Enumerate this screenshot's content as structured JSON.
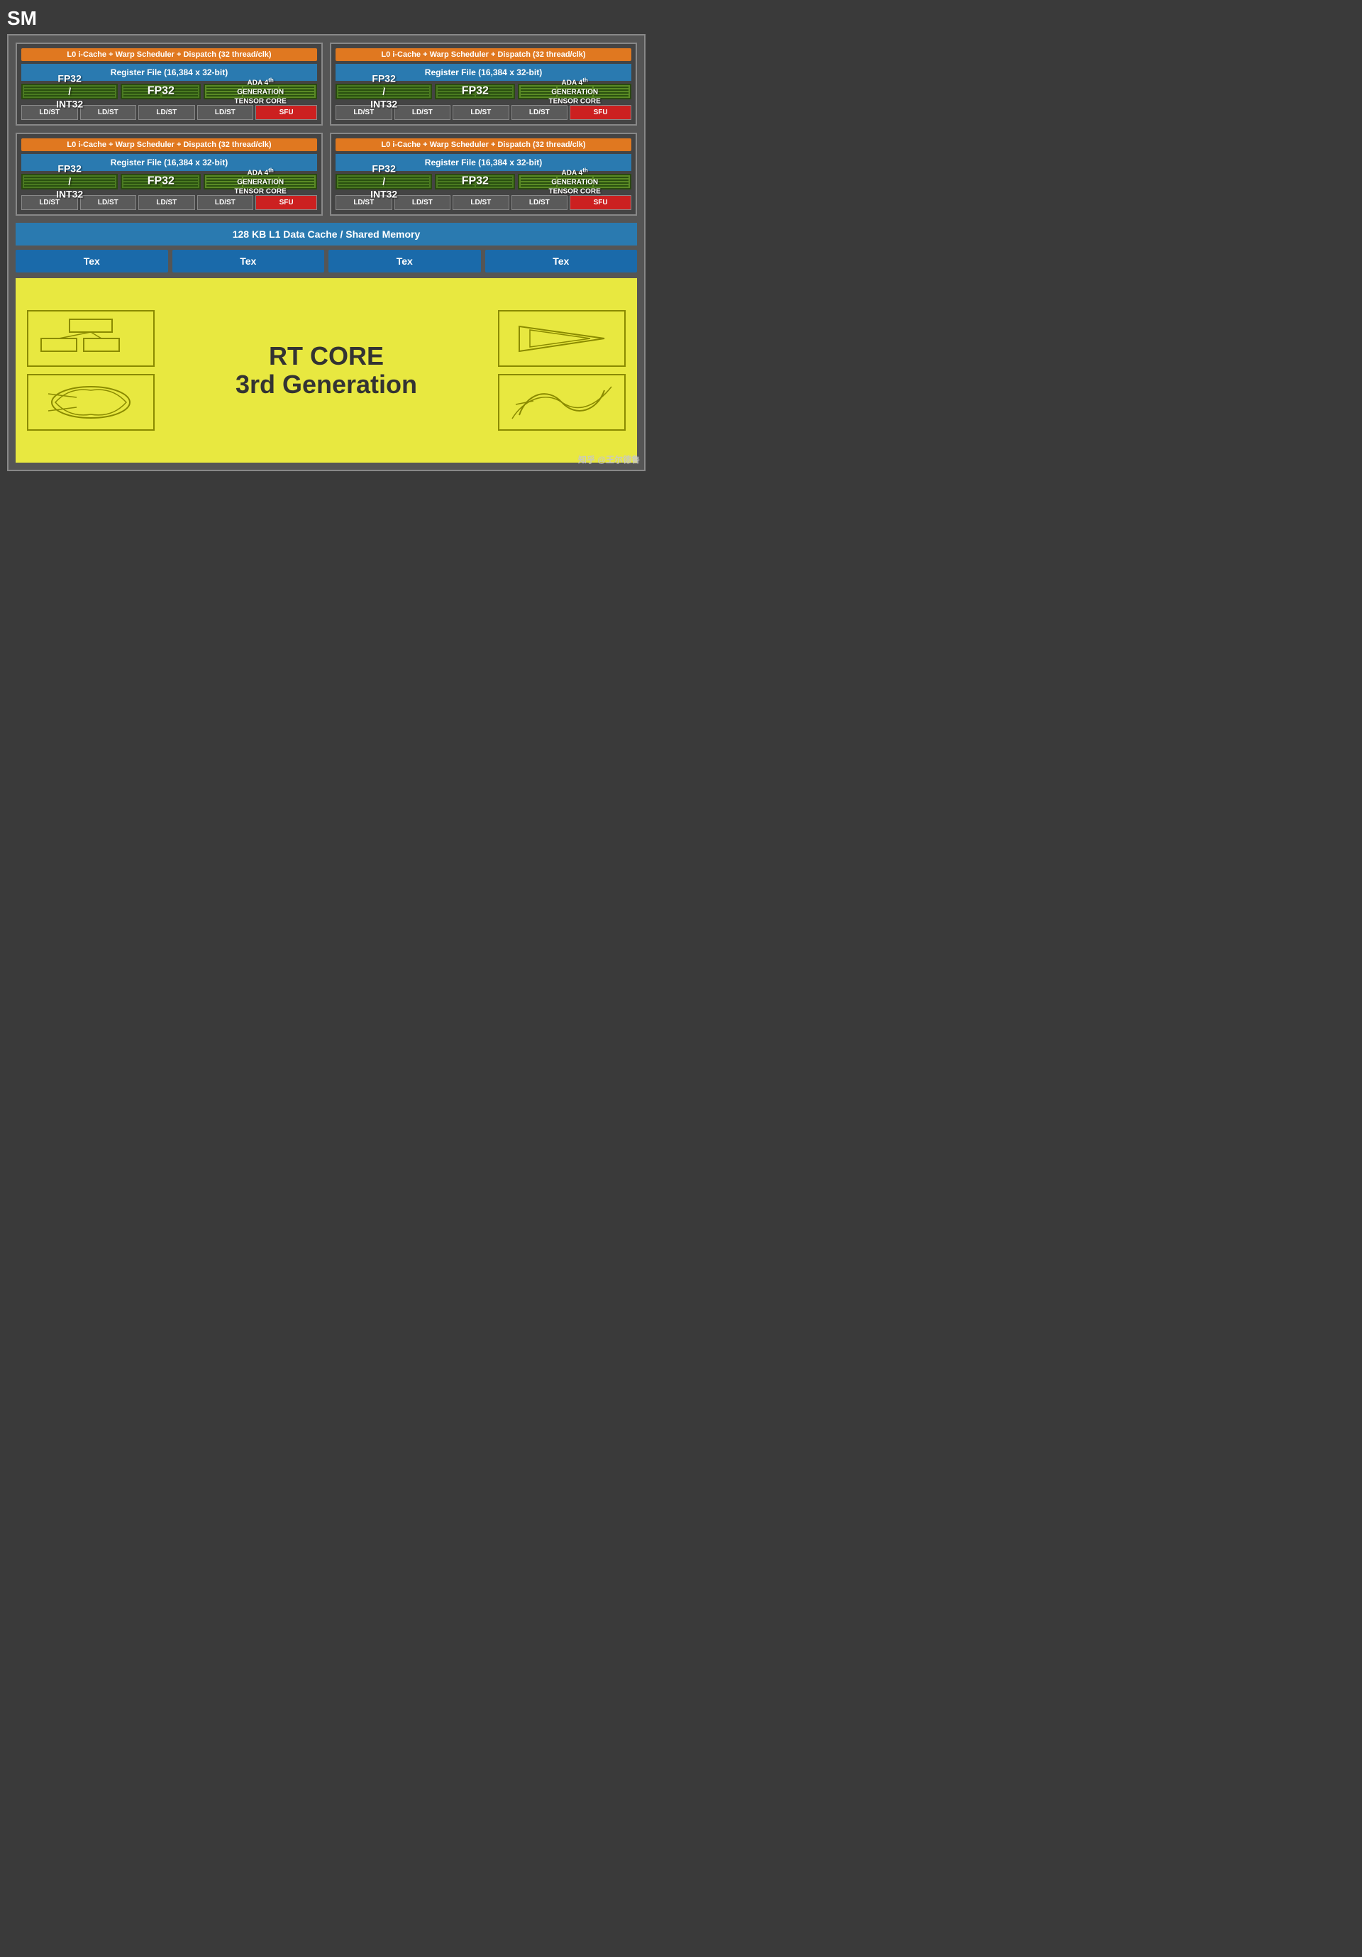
{
  "title": "SM",
  "quadrants": [
    {
      "id": "q1",
      "warp_label": "L0 i-Cache + Warp Scheduler + Dispatch (32 thread/clk)",
      "register_label": "Register File (16,384 x 32-bit)",
      "fp32_int32_label": "FP32\n/\nINT32",
      "fp32_label": "FP32",
      "tensor_label": "ADA 4th GENERATION TENSOR CORE",
      "ldst_labels": [
        "LD/ST",
        "LD/ST",
        "LD/ST",
        "LD/ST"
      ],
      "sfu_label": "SFU"
    },
    {
      "id": "q2",
      "warp_label": "L0 i-Cache + Warp Scheduler + Dispatch (32 thread/clk)",
      "register_label": "Register File (16,384 x 32-bit)",
      "fp32_int32_label": "FP32\n/\nINT32",
      "fp32_label": "FP32",
      "tensor_label": "ADA 4th GENERATION TENSOR CORE",
      "ldst_labels": [
        "LD/ST",
        "LD/ST",
        "LD/ST",
        "LD/ST"
      ],
      "sfu_label": "SFU"
    },
    {
      "id": "q3",
      "warp_label": "L0 i-Cache + Warp Scheduler + Dispatch (32 thread/clk)",
      "register_label": "Register File (16,384 x 32-bit)",
      "fp32_int32_label": "FP32\n/\nINT32",
      "fp32_label": "FP32",
      "tensor_label": "ADA 4th GENERATION TENSOR CORE",
      "ldst_labels": [
        "LD/ST",
        "LD/ST",
        "LD/ST",
        "LD/ST"
      ],
      "sfu_label": "SFU"
    },
    {
      "id": "q4",
      "warp_label": "L0 i-Cache + Warp Scheduler + Dispatch (32 thread/clk)",
      "register_label": "Register File (16,384 x 32-bit)",
      "fp32_int32_label": "FP32\n/\nINT32",
      "fp32_label": "FP32",
      "tensor_label": "ADA 4th GENERATION TENSOR CORE",
      "ldst_labels": [
        "LD/ST",
        "LD/ST",
        "LD/ST",
        "LD/ST"
      ],
      "sfu_label": "SFU"
    }
  ],
  "l1_cache_label": "128 KB L1 Data Cache / Shared Memory",
  "tex_labels": [
    "Tex",
    "Tex",
    "Tex",
    "Tex"
  ],
  "rt_core": {
    "title": "RT CORE",
    "subtitle": "3rd Generation"
  },
  "watermark": "知乎 @王尔德鲁"
}
